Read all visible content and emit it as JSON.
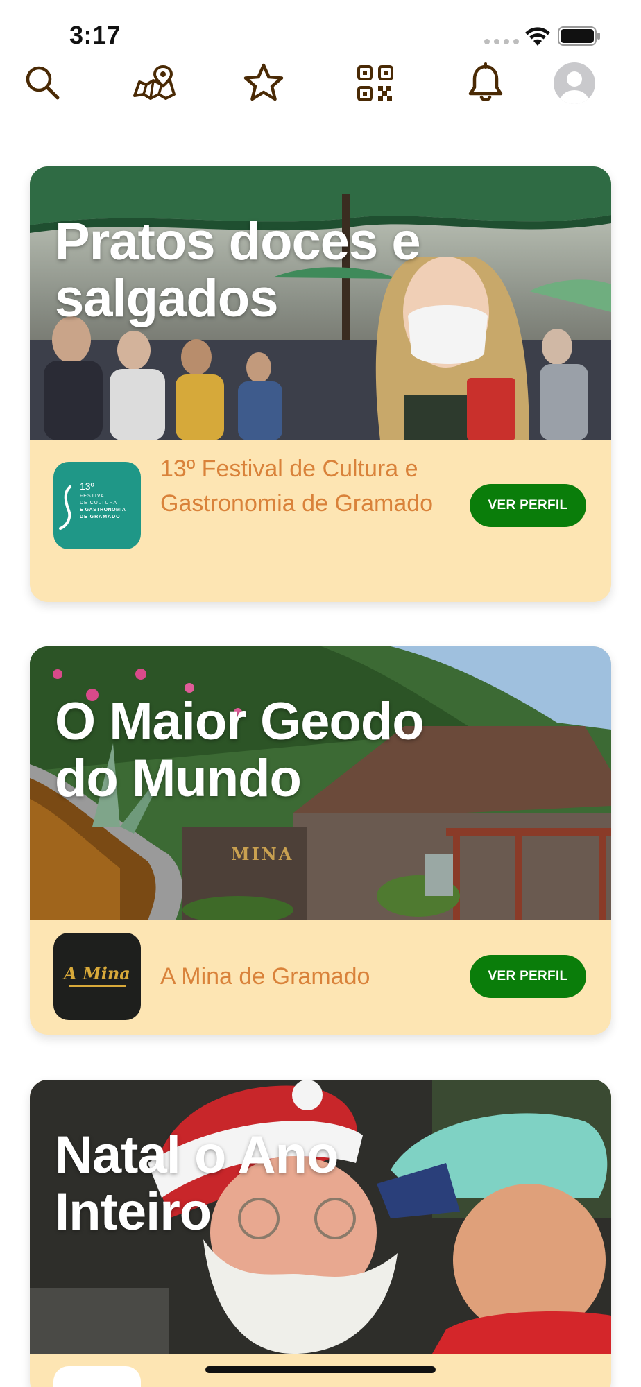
{
  "status_bar": {
    "time": "3:17"
  },
  "nav": {
    "icons": [
      "search-icon",
      "map-icon",
      "star-icon",
      "qr-code-icon",
      "bell-icon",
      "avatar-icon"
    ],
    "icon_color": "#4a2a05"
  },
  "cards": [
    {
      "title": "Pratos doces e salgados",
      "organization": "13º Festival de Cultura e Gastronomia de Gramado",
      "logo_text": {
        "line1": "13º",
        "line2": "FESTIVAL",
        "line3": "DE CULTURA",
        "line4": "E GASTRONOMIA",
        "line5": "DE GRAMADO"
      },
      "button_label": "VER PERFIL"
    },
    {
      "title": "O Maior Geodo do Mundo",
      "organization": "A Mina de Gramado",
      "logo_text": {
        "line1": "A Mina"
      },
      "image_sign": "MINA",
      "button_label": "VER PERFIL"
    },
    {
      "title": "Natal o Ano Inteiro"
    }
  ],
  "colors": {
    "card_footer": "#fde5b3",
    "org_name": "#d9823a",
    "button": "#0a7d0a"
  }
}
